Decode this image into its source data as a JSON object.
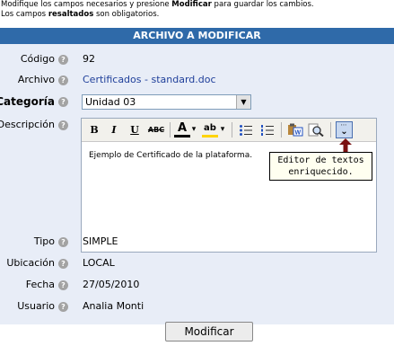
{
  "intro": {
    "line1_a": "Modifique los campos necesarios y presione ",
    "line1_b": "Modificar",
    "line1_c": " para guardar los cambios.",
    "line2_a": "Los campos ",
    "line2_b": "resaltados",
    "line2_c": " son obligatorios."
  },
  "panel": {
    "title": "ARCHIVO A MODIFICAR"
  },
  "help_glyph": "?",
  "fields": {
    "codigo": {
      "label": "Código",
      "value": "92"
    },
    "archivo": {
      "label": "Archivo",
      "value": "Certificados - standard.doc"
    },
    "categoria": {
      "label": "Categoría",
      "value": "Unidad 03"
    },
    "descripcion": {
      "label": "Descripción",
      "value": "Ejemplo de Certificado de la plataforma."
    },
    "tipo": {
      "label": "Tipo",
      "value": "SIMPLE"
    },
    "ubicacion": {
      "label": "Ubicación",
      "value": "LOCAL"
    },
    "fecha": {
      "label": "Fecha",
      "value": "27/05/2010"
    },
    "usuario": {
      "label": "Usuario",
      "value": "Analia Monti"
    }
  },
  "toolbar": {
    "bold": "B",
    "italic": "I",
    "underline": "U",
    "strike": "ABC",
    "font_color": "A",
    "highlight": "ab",
    "dropdown": "▾",
    "expand": "⌄"
  },
  "tooltip": {
    "line1": "Editor de textos",
    "line2": "enriquecido."
  },
  "submit_label": "Modificar",
  "colors": {
    "title_bar": "#2f6aa9",
    "panel_bg": "#e8edf7",
    "link": "#1f3f9a",
    "arrow": "#7a1010"
  }
}
